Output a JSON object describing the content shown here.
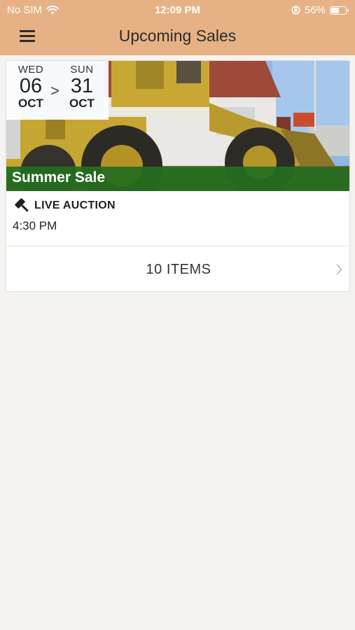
{
  "status_bar": {
    "carrier": "No SIM",
    "time": "12:09 PM",
    "battery": "56%",
    "battery_level": 0.56,
    "icons": [
      "wifi-icon",
      "orientation-lock-icon",
      "battery-icon"
    ]
  },
  "nav": {
    "title": "Upcoming Sales",
    "menu_icon": "hamburger-menu-icon"
  },
  "sale": {
    "start": {
      "dow": "WED",
      "day": "06",
      "month": "OCT"
    },
    "separator": ">",
    "end": {
      "dow": "SUN",
      "day": "31",
      "month": "OCT"
    },
    "title": "Summer Sale",
    "type_icon": "gavel-icon",
    "type_label": "LIVE AUCTION",
    "time": "4:30 PM",
    "items_label": "10 ITEMS",
    "items_icon": "chevron-right-icon"
  },
  "colors": {
    "header": "#e6b285",
    "banner": "#236e1e",
    "background": "#f4f3f0"
  }
}
